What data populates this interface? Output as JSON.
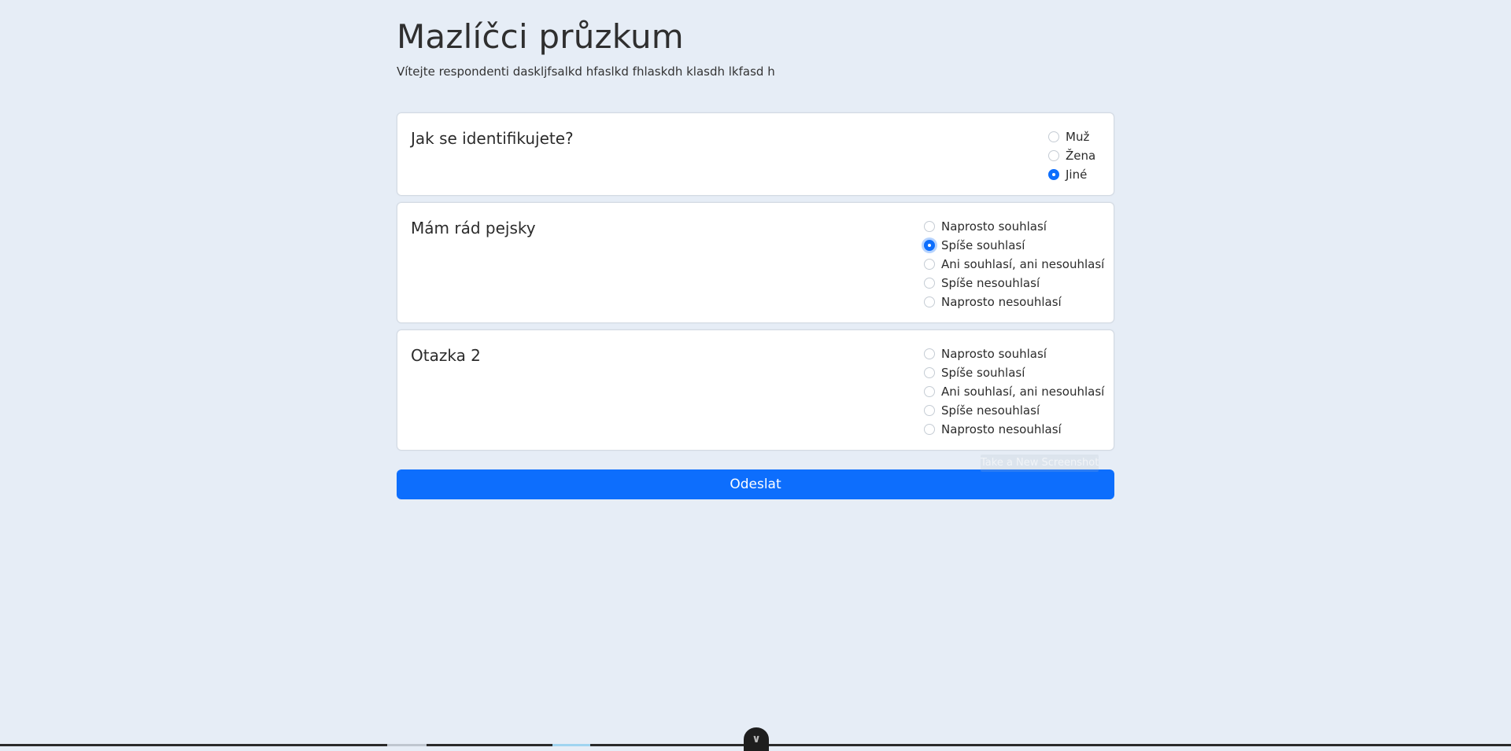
{
  "header": {
    "title": "Mazlíčci průzkum",
    "subtitle": "Vítejte respondenti daskljfsalkd hfaslkd fhlaskdh klasdh lkfasd h"
  },
  "questions": [
    {
      "text": "Jak se identifikujete?",
      "options": [
        "Muž",
        "Žena",
        "Jiné"
      ],
      "selected": "Jiné"
    },
    {
      "text": "Mám rád pejsky",
      "options": [
        "Naprosto souhlasí",
        "Spíše souhlasí",
        "Ani souhlasí, ani nesouhlasí",
        "Spíše nesouhlasí",
        "Naprosto nesouhlasí"
      ],
      "selected": "Spíše souhlasí"
    },
    {
      "text": "Otazka 2",
      "options": [
        "Naprosto souhlasí",
        "Spíše souhlasí",
        "Ani souhlasí, ani nesouhlasí",
        "Spíše nesouhlasí",
        "Naprosto nesouhlasí"
      ],
      "selected": null
    }
  ],
  "submit_label": "Odeslat",
  "overlay_label": "Take a New Screenshot",
  "bottom_toggle_icon": "chevron-down-icon",
  "colors": {
    "background": "#e6edf6",
    "accent": "#0d6efd"
  }
}
